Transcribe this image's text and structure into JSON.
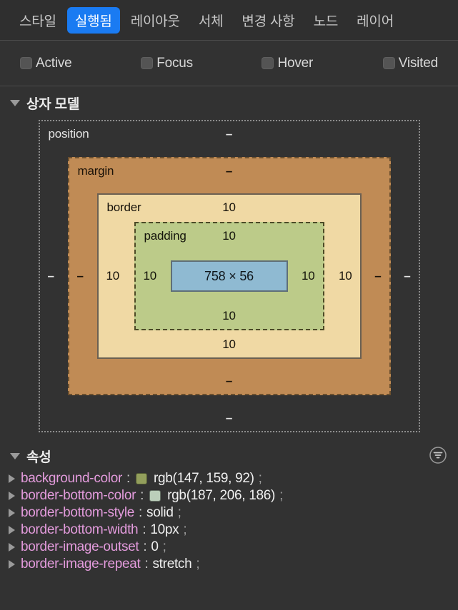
{
  "tabs": [
    {
      "label": "스타일",
      "selected": false
    },
    {
      "label": "실행됨",
      "selected": true
    },
    {
      "label": "레이아웃",
      "selected": false
    },
    {
      "label": "서체",
      "selected": false
    },
    {
      "label": "변경 사항",
      "selected": false
    },
    {
      "label": "노드",
      "selected": false
    },
    {
      "label": "레이어",
      "selected": false
    }
  ],
  "pseudo_states": [
    {
      "label": "Active",
      "checked": false
    },
    {
      "label": "Focus",
      "checked": false
    },
    {
      "label": "Hover",
      "checked": false
    },
    {
      "label": "Visited",
      "checked": false
    }
  ],
  "box_model": {
    "section_title": "상자 모델",
    "position": {
      "name": "position",
      "top": "–",
      "right": "–",
      "bottom": "–",
      "left": "–"
    },
    "margin": {
      "name": "margin",
      "top": "–",
      "right": "–",
      "bottom": "–",
      "left": "–"
    },
    "border": {
      "name": "border",
      "top": "10",
      "right": "10",
      "bottom": "10",
      "left": "10"
    },
    "padding": {
      "name": "padding",
      "top": "10",
      "right": "10",
      "bottom": "10",
      "left": "10"
    },
    "content": {
      "size": "758 × 56"
    },
    "colors": {
      "position_bg": "#323232",
      "margin_bg": "#c08b55",
      "border_bg": "#f0d9a4",
      "padding_bg": "#bccb89",
      "content_bg": "#8fbad2"
    }
  },
  "properties": {
    "section_title": "속성",
    "filter_icon": "filter-icon",
    "rows": [
      {
        "name": "background-color",
        "value": "rgb(147, 159, 92)",
        "swatch": "rgb(147, 159, 92)"
      },
      {
        "name": "border-bottom-color",
        "value": "rgb(187, 206, 186)",
        "swatch": "rgb(187, 206, 186)"
      },
      {
        "name": "border-bottom-style",
        "value": "solid",
        "swatch": null
      },
      {
        "name": "border-bottom-width",
        "value": "10px",
        "swatch": null
      },
      {
        "name": "border-image-outset",
        "value": "0",
        "swatch": null
      },
      {
        "name": "border-image-repeat",
        "value": "stretch",
        "swatch": null
      }
    ]
  },
  "accent_color": "#1a7bf2"
}
